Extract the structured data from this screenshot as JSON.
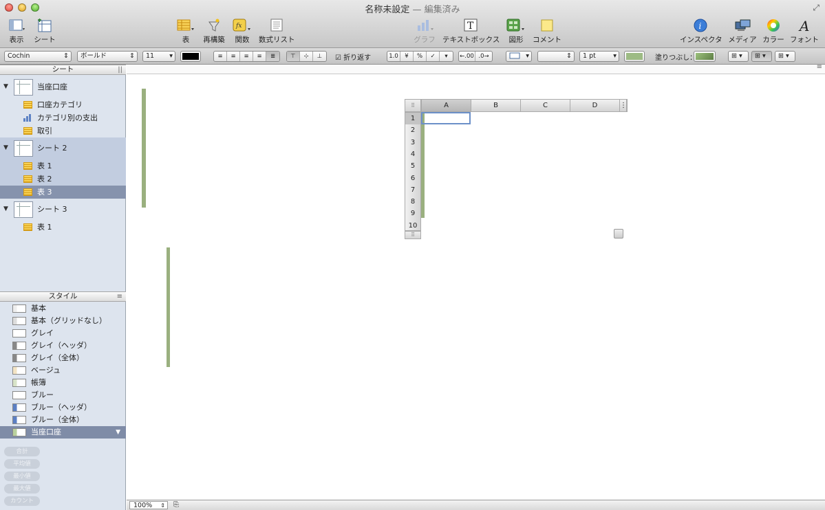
{
  "window": {
    "title": "名称未設定",
    "title_suffix": "— 編集済み"
  },
  "toolbar": {
    "view": "表示",
    "sheet": "シート",
    "table": "表",
    "reorganize": "再構築",
    "function": "関数",
    "formula_list": "数式リスト",
    "chart": "グラフ",
    "textbox": "テキストボックス",
    "shape": "図形",
    "comment": "コメント",
    "inspector": "インスペクタ",
    "media": "メディア",
    "colors": "カラー",
    "fonts": "フォント"
  },
  "format_bar": {
    "font_family": "Cochin",
    "font_style": "ボールド",
    "font_size": "11",
    "wrap_label": "折り返す",
    "stroke_width": "1 pt",
    "fill_label": "塗りつぶし：",
    "number_buttons": [
      "1.0",
      "¥",
      "%",
      "✓",
      "▾"
    ],
    "decimal_buttons": [
      "←.00",
      ".0→"
    ],
    "text_color": "#000000",
    "stroke_color": "#9dbb84",
    "fill_color": "#7e9f62"
  },
  "sidebar": {
    "header": "シート",
    "sheets": [
      {
        "name": "当座口座",
        "items": [
          {
            "label": "口座カテゴリ",
            "icon": "table"
          },
          {
            "label": "カテゴリ別の支出",
            "icon": "chart"
          },
          {
            "label": "取引",
            "icon": "table"
          }
        ]
      },
      {
        "name": "シート 2",
        "items": [
          {
            "label": "表 1",
            "icon": "table"
          },
          {
            "label": "表 2",
            "icon": "table"
          },
          {
            "label": "表 3",
            "icon": "table"
          }
        ]
      },
      {
        "name": "シート 3",
        "items": [
          {
            "label": "表 1",
            "icon": "table"
          }
        ]
      }
    ],
    "selected_item": "シート 2 / 表 3"
  },
  "styles": {
    "header": "スタイル",
    "items": [
      "基本",
      "基本（グリッドなし）",
      "グレイ",
      "グレイ（ヘッダ）",
      "グレイ（全体）",
      "ベージュ",
      "帳簿",
      "ブルー",
      "ブルー（ヘッダ）",
      "ブルー（全体）",
      "当座口座"
    ],
    "selected": "当座口座"
  },
  "summary_buttons": [
    "合計",
    "平均値",
    "最小値",
    "最大値",
    "カウント"
  ],
  "active_table": {
    "columns": [
      "A",
      "B",
      "C",
      "D"
    ],
    "rows": [
      "1",
      "2",
      "3",
      "4",
      "5",
      "6",
      "7",
      "8",
      "9",
      "10"
    ],
    "selected_cell": "A1"
  },
  "statusbar": {
    "zoom": "100%"
  },
  "colors": {
    "header_fill": "#dbe7c6",
    "grid_line": "#9ab07f",
    "sidebar_bg": "#dde4ee",
    "selection": "#8693ad"
  }
}
